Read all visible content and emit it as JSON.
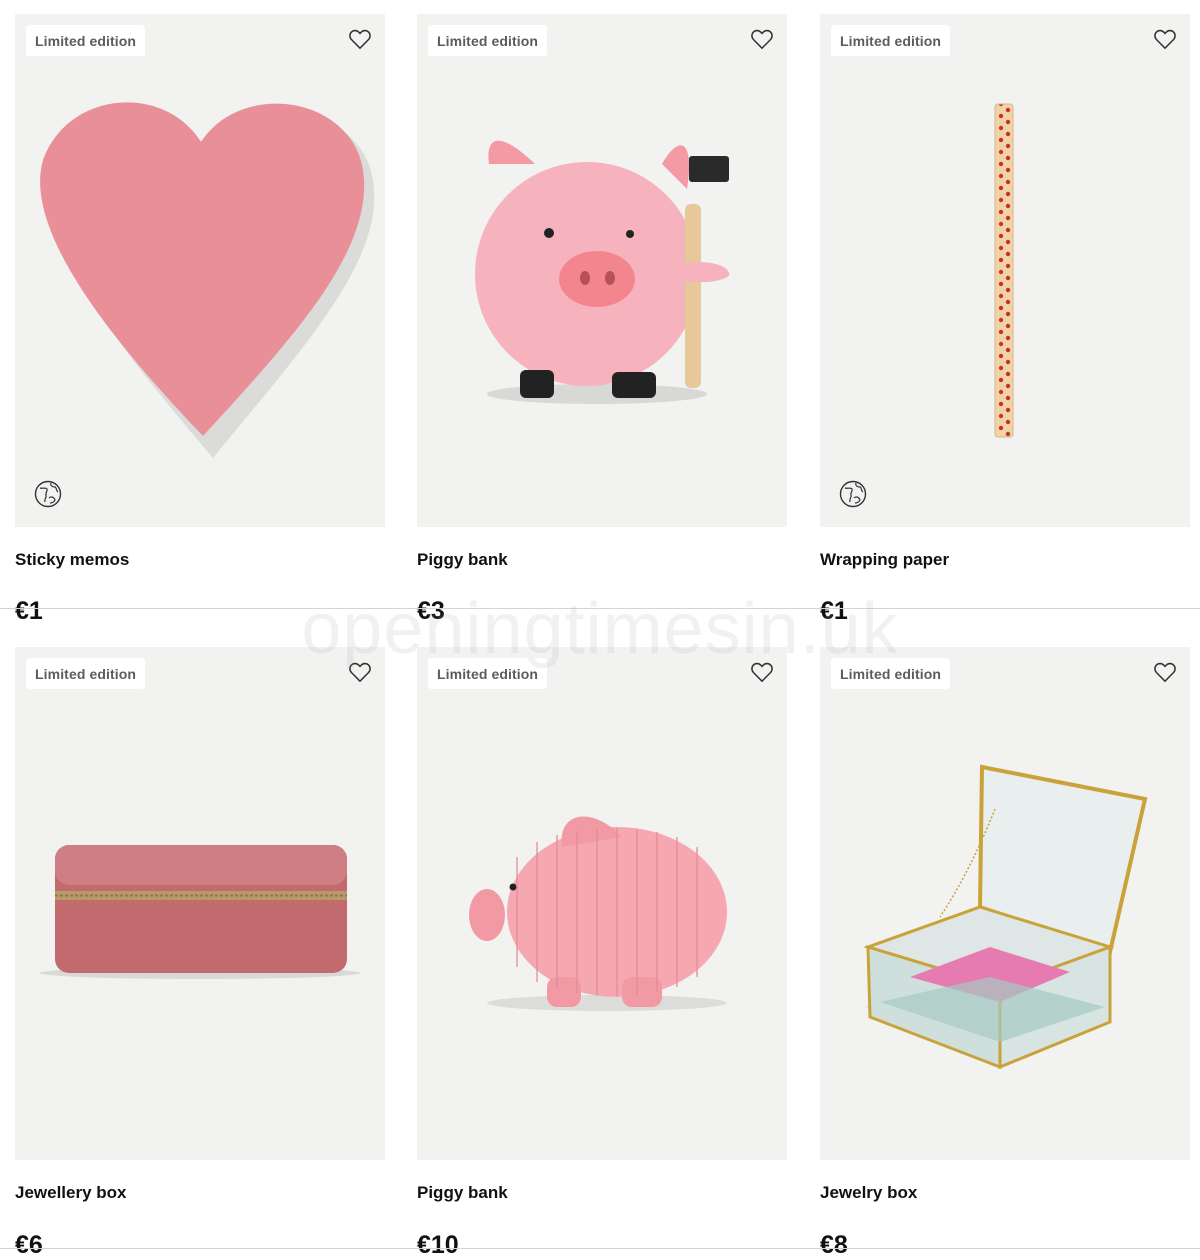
{
  "badge_label": "Limited edition",
  "watermark": "openingtimesin.uk",
  "colors": {
    "card_bg": "#f2f2f1",
    "text": "#111111",
    "badge_text": "#5c5c5c"
  },
  "products": [
    {
      "name": "Sticky memos",
      "price": "€1",
      "eco_icon": "globe-leaf-icon",
      "favorite_icon": "heart-outline-icon"
    },
    {
      "name": "Piggy bank",
      "price": "€3",
      "favorite_icon": "heart-outline-icon"
    },
    {
      "name": "Wrapping paper",
      "price": "€1",
      "eco_icon": "globe-leaf-icon",
      "favorite_icon": "heart-outline-icon"
    },
    {
      "name": "Jewellery box",
      "price": "€6",
      "favorite_icon": "heart-outline-icon"
    },
    {
      "name": "Piggy bank",
      "price": "€10",
      "favorite_icon": "heart-outline-icon"
    },
    {
      "name": "Jewelry box",
      "price": "€8",
      "favorite_icon": "heart-outline-icon"
    }
  ]
}
